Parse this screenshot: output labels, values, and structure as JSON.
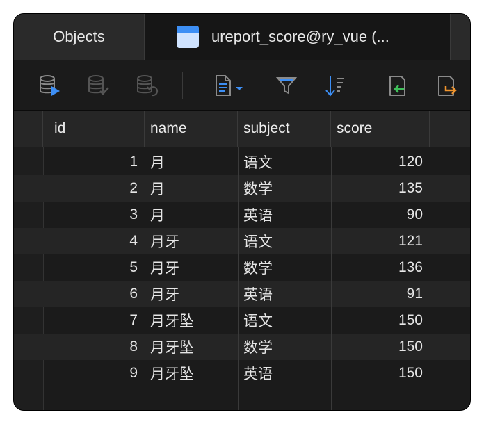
{
  "tabs": {
    "objects_label": "Objects",
    "table_label": "ureport_score@ry_vue (..."
  },
  "toolbar": {
    "buttons": [
      {
        "name": "begin-transaction-icon",
        "color": "#3d8ff5",
        "enabled": true
      },
      {
        "name": "commit-icon",
        "color": "#5a5a5a",
        "enabled": false
      },
      {
        "name": "rollback-icon",
        "color": "#5a5a5a",
        "enabled": false
      },
      {
        "name": "text-view-icon",
        "color": "#3d8ff5",
        "enabled": true
      },
      {
        "name": "filter-icon",
        "color": "#3d8ff5",
        "enabled": true
      },
      {
        "name": "sort-icon",
        "color": "#3d8ff5",
        "enabled": true
      },
      {
        "name": "import-icon",
        "color": "#3fbf5a",
        "enabled": true
      },
      {
        "name": "export-icon",
        "color": "#f0942d",
        "enabled": true
      }
    ]
  },
  "table": {
    "columns": [
      "id",
      "name",
      "subject",
      "score"
    ],
    "rows": [
      {
        "id": "1",
        "name": "月",
        "subject": "语文",
        "score": "120"
      },
      {
        "id": "2",
        "name": "月",
        "subject": "数学",
        "score": "135"
      },
      {
        "id": "3",
        "name": "月",
        "subject": "英语",
        "score": "90"
      },
      {
        "id": "4",
        "name": "月牙",
        "subject": "语文",
        "score": "121"
      },
      {
        "id": "5",
        "name": "月牙",
        "subject": "数学",
        "score": "136"
      },
      {
        "id": "6",
        "name": "月牙",
        "subject": "英语",
        "score": "91"
      },
      {
        "id": "7",
        "name": "月牙坠",
        "subject": "语文",
        "score": "150"
      },
      {
        "id": "8",
        "name": "月牙坠",
        "subject": "数学",
        "score": "150"
      },
      {
        "id": "9",
        "name": "月牙坠",
        "subject": "英语",
        "score": "150"
      }
    ]
  }
}
